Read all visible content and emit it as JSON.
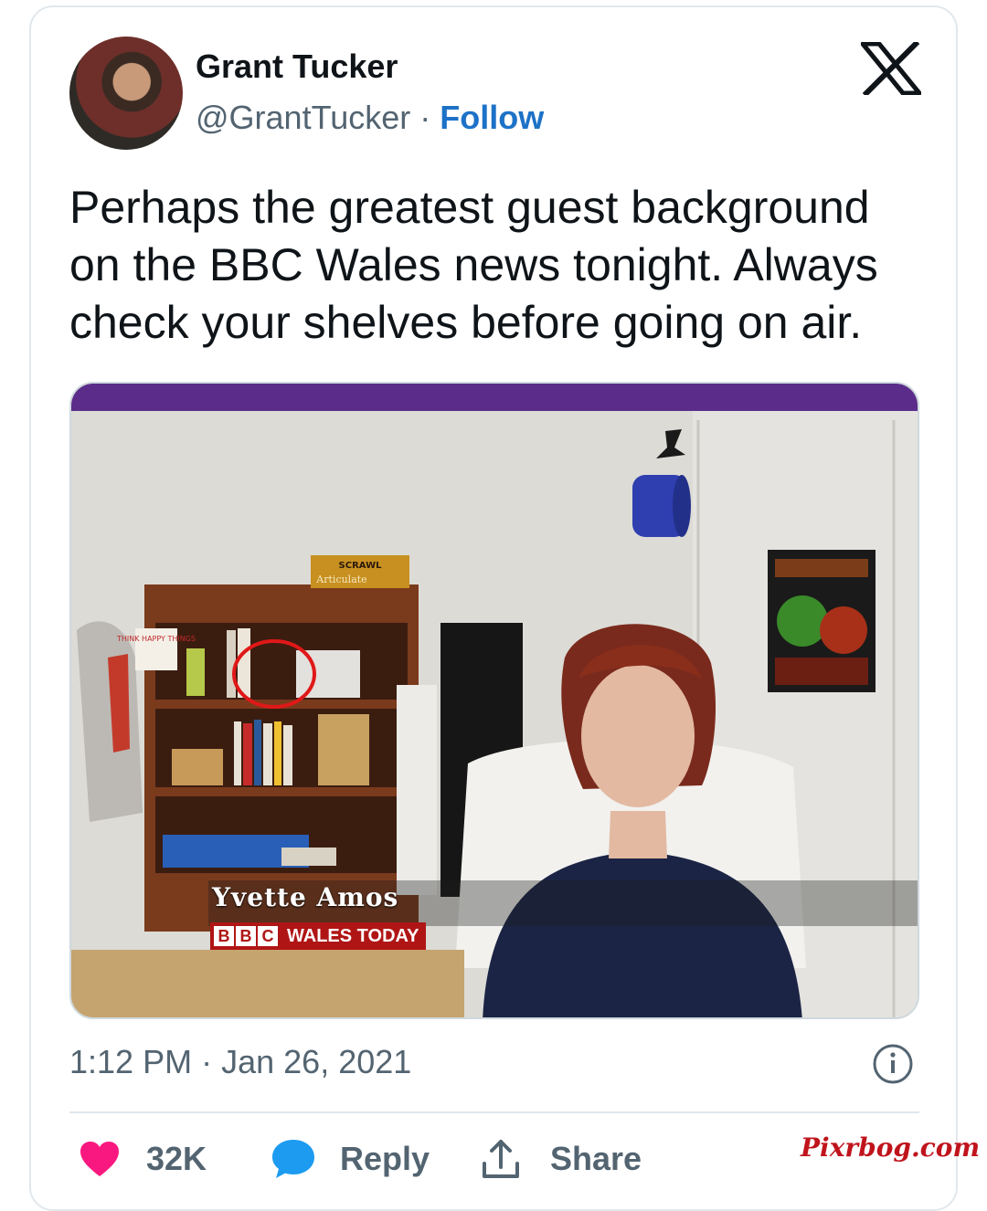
{
  "author": {
    "name": "Grant Tucker",
    "handle": "@GrantTucker",
    "separator": "·",
    "follow_label": "Follow"
  },
  "brand_icon": "x-logo-icon",
  "tweet": {
    "text": "Perhaps the greatest guest background on the BBC Wales news tonight. Always check your shelves before going on air."
  },
  "media": {
    "lower_third_name": "Yvette Amos",
    "channel_letters": [
      "B",
      "B",
      "C"
    ],
    "show_name": "WALES TODAY",
    "box_labels": {
      "game_top": "SCRAWL",
      "game_bottom": "Articulate"
    },
    "sign_text": "THINK HAPPY THINGS"
  },
  "meta": {
    "time": "1:12 PM",
    "separator": "·",
    "date": "Jan 26, 2021"
  },
  "actions": {
    "like_count": "32K",
    "reply_label": "Reply",
    "share_label": "Share"
  },
  "watermark": "Pixrbog.com",
  "colors": {
    "accent": "#1d72c7",
    "like": "#f91880",
    "reply": "#1d9bf0",
    "bbc_red": "#b01515"
  }
}
